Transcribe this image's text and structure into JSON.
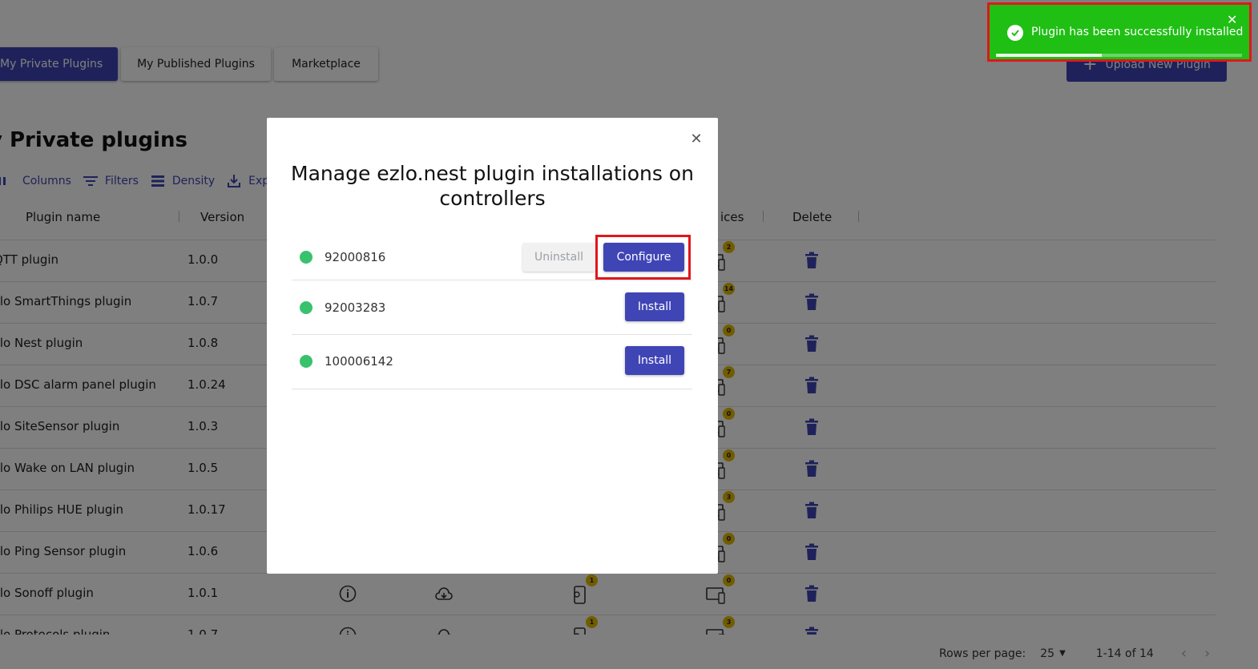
{
  "tabs": [
    {
      "label": "My Private Plugins",
      "active": true
    },
    {
      "label": "My Published Plugins",
      "active": false
    },
    {
      "label": "Marketplace",
      "active": false
    }
  ],
  "upload_button": {
    "label": "Upload New Plugin",
    "icon": "plus-icon"
  },
  "page_title": "y Private plugins",
  "toolbar": {
    "columns": "Columns",
    "filters": "Filters",
    "density": "Density",
    "export": "Export"
  },
  "table": {
    "headers": {
      "plugin_name": "Plugin name",
      "version": "Version",
      "devices": "ices",
      "delete": "Delete"
    },
    "rows": [
      {
        "name": "QTT plugin",
        "version": "1.0.0",
        "devices": "",
        "controllers": "2"
      },
      {
        "name": "zlo SmartThings plugin",
        "version": "1.0.7",
        "devices": "",
        "controllers": "14"
      },
      {
        "name": "zlo Nest plugin",
        "version": "1.0.8",
        "devices": "",
        "controllers": "0"
      },
      {
        "name": "zlo DSC alarm panel plugin",
        "version": "1.0.24",
        "devices": "",
        "controllers": "7"
      },
      {
        "name": "zlo SiteSensor plugin",
        "version": "1.0.3",
        "devices": "",
        "controllers": "0"
      },
      {
        "name": "zlo Wake on LAN plugin",
        "version": "1.0.5",
        "devices": "",
        "controllers": "0"
      },
      {
        "name": "zlo Philips HUE plugin",
        "version": "1.0.17",
        "devices": "",
        "controllers": "3"
      },
      {
        "name": "zlo Ping Sensor plugin",
        "version": "1.0.6",
        "devices": "",
        "controllers": "0"
      },
      {
        "name": "zlo Sonoff plugin",
        "version": "1.0.1",
        "devices": "1",
        "controllers": "0"
      },
      {
        "name": "zlo Protocols plugin",
        "version": "1.0.7",
        "devices": "1",
        "controllers": "3"
      }
    ]
  },
  "pagination": {
    "rows_per_page_label": "Rows per page:",
    "rows_per_page_value": "25",
    "range": "1-14 of 14"
  },
  "modal": {
    "title": "Manage ezlo.nest plugin installations on controllers",
    "controllers": [
      {
        "id": "92000816",
        "status_color": "#39c26e",
        "installed": true,
        "uninstall_label": "Uninstall",
        "configure_label": "Configure"
      },
      {
        "id": "92003283",
        "status_color": "#39c26e",
        "installed": false,
        "install_label": "Install"
      },
      {
        "id": "100006142",
        "status_color": "#39c26e",
        "installed": false,
        "install_label": "Install"
      }
    ]
  },
  "toast": {
    "message": "Plugin has been successfully installed",
    "progress": 0.43,
    "color": "#1fbf14"
  },
  "colors": {
    "primary": "#3f45b5",
    "badge": "#e3b900",
    "status_online": "#39c26e",
    "highlight": "#e0171b"
  }
}
